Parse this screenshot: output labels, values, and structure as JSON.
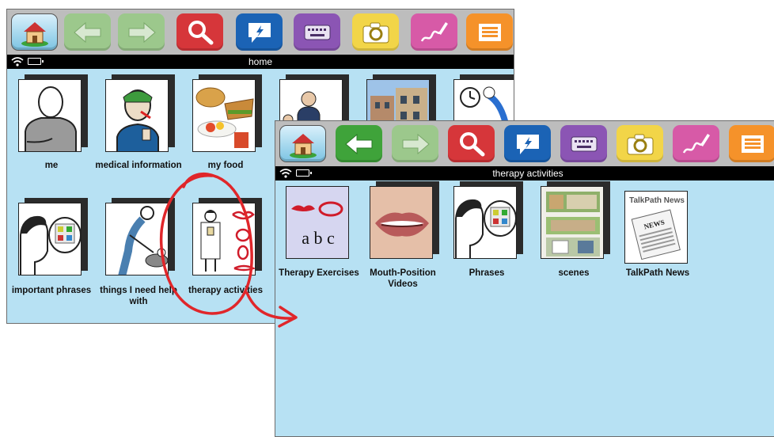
{
  "window_home": {
    "title": "home",
    "toolbar": [
      "home-button",
      "back-button",
      "forward-button",
      "search-button",
      "speak-button",
      "keyboard-button",
      "camera-button",
      "draw-button",
      "menu-button"
    ],
    "tiles": [
      {
        "label": "me"
      },
      {
        "label": "medical information"
      },
      {
        "label": "my food"
      },
      {
        "label": ""
      },
      {
        "label": ""
      },
      {
        "label": ""
      },
      {
        "label": "important phrases"
      },
      {
        "label": "things I need help with"
      },
      {
        "label": "therapy activities"
      }
    ]
  },
  "window_therapy": {
    "title": "therapy activities",
    "tiles": [
      {
        "label": "Therapy Exercises",
        "card_text": "a b c"
      },
      {
        "label": "Mouth-Position Videos"
      },
      {
        "label": "Phrases"
      },
      {
        "label": "scenes"
      },
      {
        "label": "TalkPath News",
        "logo_text": "TalkPath News",
        "paper_text": "NEWS"
      }
    ]
  },
  "colors": {
    "panel": "#b7e1f3",
    "toolbar": "#bdbdbd",
    "annotation": "#e0262a"
  }
}
